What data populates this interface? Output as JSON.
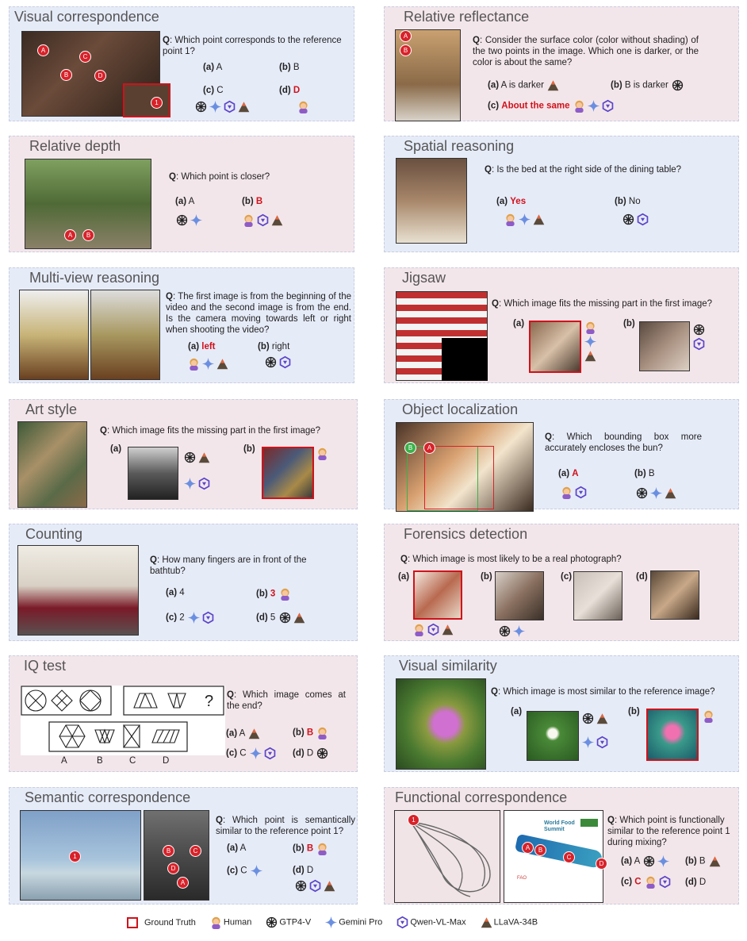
{
  "panels": {
    "visual_correspondence": {
      "title": "Visual correspondence",
      "q": "Which point corresponds to the reference point 1?",
      "opts": [
        "(a)",
        "A",
        "(b)",
        "B",
        "(c)",
        "C",
        "(d)",
        "D"
      ],
      "points": [
        "A",
        "B",
        "C",
        "D",
        "1"
      ]
    },
    "relative_reflectance": {
      "title": "Relative reflectance",
      "q": "Consider the surface color (color without shading) of the two points in the image. Which one is darker, or the color is about the same?",
      "opts": [
        "(a)",
        "A is darker",
        "(b)",
        "B is darker",
        "(c)",
        "About the same"
      ],
      "points": [
        "A",
        "B"
      ]
    },
    "relative_depth": {
      "title": "Relative depth",
      "q": "Which point is closer?",
      "opts": [
        "(a)",
        "A",
        "(b)",
        "B"
      ],
      "points": [
        "A",
        "B"
      ]
    },
    "spatial_reasoning": {
      "title": "Spatial reasoning",
      "q": "Is the bed at the right side of the dining table?",
      "opts": [
        "(a)",
        "Yes",
        "(b)",
        "No"
      ]
    },
    "multi_view": {
      "title": "Multi-view reasoning",
      "q": "The first image is from the beginning of the video and the second image is from the end. Is the camera moving towards left or right when shooting the video?",
      "opts": [
        "(a)",
        "left",
        "(b)",
        "right"
      ]
    },
    "jigsaw": {
      "title": "Jigsaw",
      "q": "Which image fits the missing part in the first image?",
      "opts": [
        "(a)",
        "(b)"
      ]
    },
    "art_style": {
      "title": "Art style",
      "q": "Which image fits the missing part in the first image?",
      "opts": [
        "(a)",
        "(b)"
      ]
    },
    "object_localization": {
      "title": "Object localization",
      "q": "Which bounding box more accurately encloses the bun?",
      "opts": [
        "(a)",
        "A",
        "(b)",
        "B"
      ],
      "points": [
        "B",
        "A"
      ]
    },
    "counting": {
      "title": "Counting",
      "q": "How many fingers are in front of the bathtub?",
      "opts": [
        "(a)",
        "4",
        "(b)",
        "3",
        "(c)",
        "2",
        "(d)",
        "5"
      ]
    },
    "forensics": {
      "title": "Forensics detection",
      "q": "Which image is most likely to be a real photograph?",
      "opts": [
        "(a)",
        "(b)",
        "(c)",
        "(d)"
      ]
    },
    "iq_test": {
      "title": "IQ test",
      "q": "Which image comes at the end?",
      "opts": [
        "(a)",
        "A",
        "(b)",
        "B",
        "(c)",
        "C",
        "(d)",
        "D"
      ],
      "letters": [
        "A",
        "B",
        "C",
        "D"
      ],
      "question_mark": "?"
    },
    "visual_similarity": {
      "title": "Visual similarity",
      "q": "Which image is most similar to the reference image?",
      "opts": [
        "(a)",
        "(b)"
      ]
    },
    "semantic_correspondence": {
      "title": "Semantic correspondence",
      "q": "Which point is semantically similar to the reference point 1?",
      "opts": [
        "(a)",
        "A",
        "(b)",
        "B",
        "(c)",
        "C",
        "(d)",
        "D"
      ],
      "points": [
        "1",
        "B",
        "C",
        "D",
        "A"
      ]
    },
    "functional_correspondence": {
      "title": "Functional correspondence",
      "q": "Which point is functionally similar to the reference point 1 during mixing?",
      "opts": [
        "(a)",
        "A",
        "(b)",
        "B",
        "(c)",
        "C",
        "(d)",
        "D"
      ],
      "points": [
        "1",
        "A",
        "B",
        "C",
        "D"
      ],
      "poster_title": "World Food Summit",
      "poster_sub": "FAO"
    }
  },
  "q_label": "Q",
  "legend": {
    "gt": "Ground Truth",
    "human": "Human",
    "gpt": "GTP4-V",
    "gemini": "Gemini Pro",
    "qwen": "Qwen-VL-Max",
    "llava": "LLaVA-34B"
  },
  "colors": {
    "blue_panel": "#e6ebf8",
    "pink_panel": "#f3e6ea",
    "gt_red": "#d0121b"
  }
}
